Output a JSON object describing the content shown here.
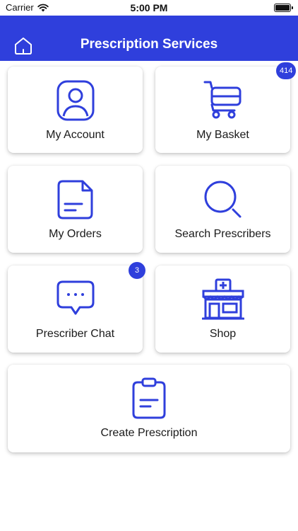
{
  "status_bar": {
    "carrier": "Carrier",
    "time": "5:00 PM",
    "battery_level": 1.0
  },
  "header": {
    "title": "Prescription Services"
  },
  "colors": {
    "accent": "#2f3fdc",
    "card_bg": "#ffffff",
    "text": "#1a1a1a"
  },
  "menu": {
    "my_account": {
      "label": "My Account",
      "icon": "user-profile-icon"
    },
    "my_basket": {
      "label": "My Basket",
      "icon": "shopping-cart-icon",
      "badge": "414"
    },
    "my_orders": {
      "label": "My Orders",
      "icon": "document-icon"
    },
    "search_prescribers": {
      "label": "Search Prescribers",
      "icon": "search-icon"
    },
    "prescriber_chat": {
      "label": "Prescriber Chat",
      "icon": "chat-bubble-icon",
      "badge": "3"
    },
    "shop": {
      "label": "Shop",
      "icon": "pharmacy-store-icon"
    },
    "create_prescription": {
      "label": "Create Prescription",
      "icon": "clipboard-icon"
    }
  }
}
